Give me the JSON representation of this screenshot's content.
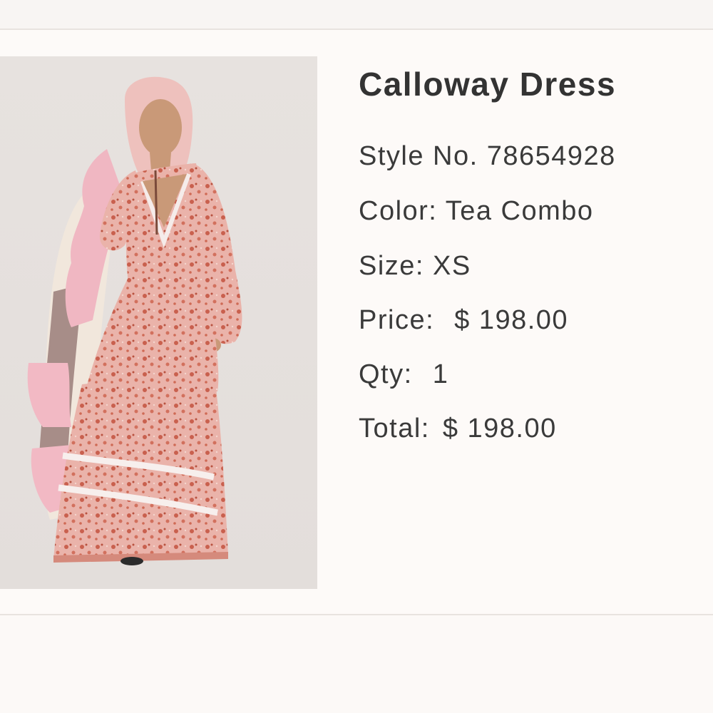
{
  "product": {
    "title": "Calloway Dress",
    "style_line": "Style No. 78654928",
    "color_line": "Color: Tea Combo",
    "size_line": "Size: XS",
    "price_label": "Price:",
    "price_value": "$ 198.00",
    "qty_label": "Qty:",
    "qty_value": "1",
    "total_label": "Total:",
    "total_value": "$ 198.00"
  },
  "image": {
    "description_name": "product-photo"
  },
  "colors": {
    "background": "#fcf9f7",
    "text": "#333333",
    "divider": "#e8e3df",
    "dress": "#e8a49a",
    "dress_print": "#c9604e"
  }
}
